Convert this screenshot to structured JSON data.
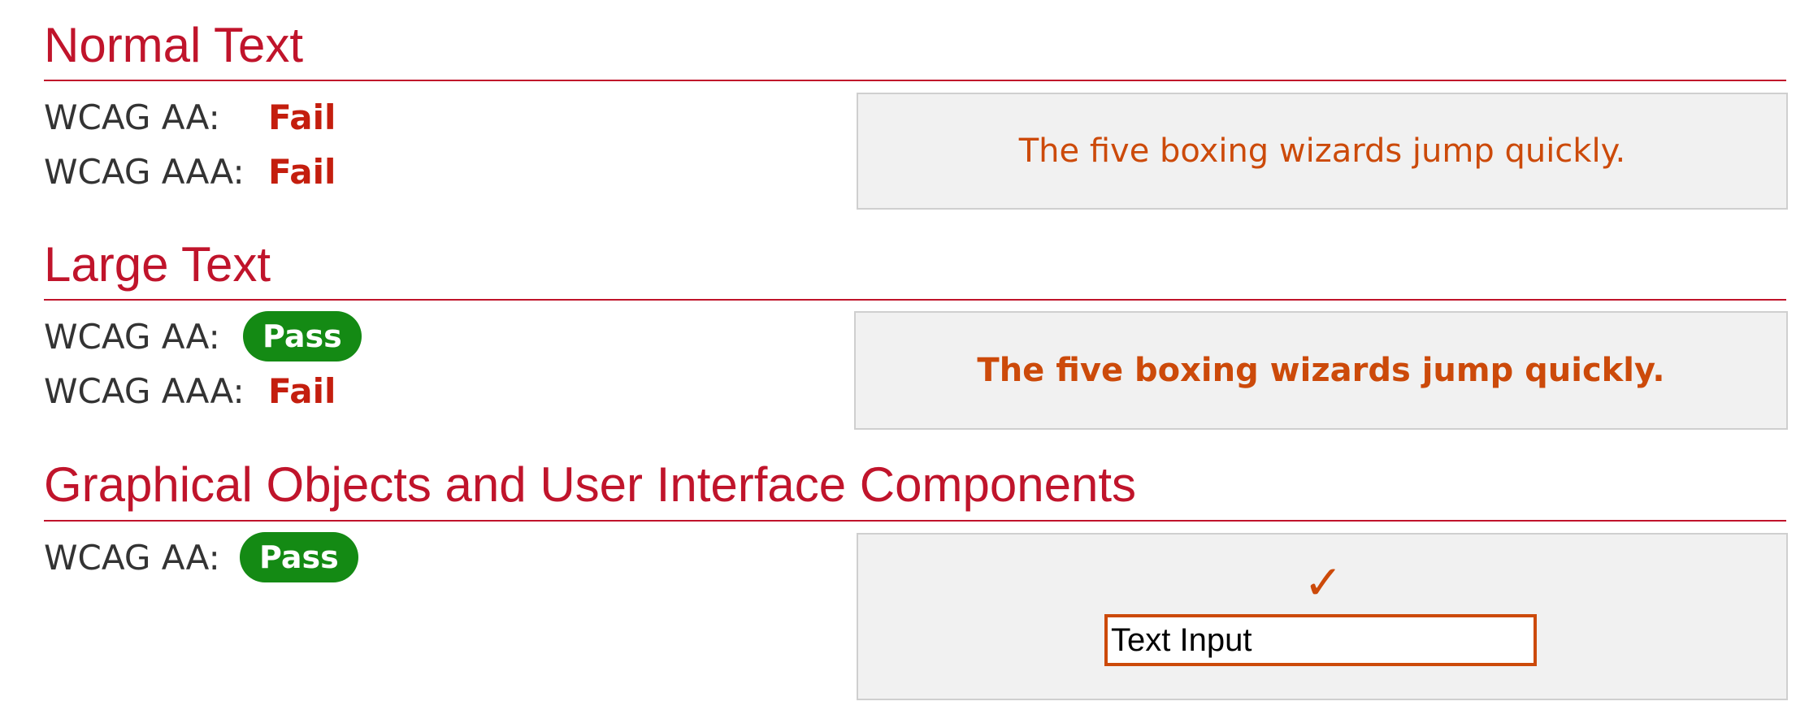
{
  "sections": [
    {
      "heading": "Normal Text",
      "rows": [
        {
          "label": "WCAG AA:",
          "result": "Fail",
          "status": "fail"
        },
        {
          "label": "WCAG AAA:",
          "result": "Fail",
          "status": "fail"
        }
      ],
      "sample_text": "The five boxing wizards jump quickly."
    },
    {
      "heading": "Large Text",
      "rows": [
        {
          "label": "WCAG AA:",
          "result": "Pass",
          "status": "pass"
        },
        {
          "label": "WCAG AAA:",
          "result": "Fail",
          "status": "fail"
        }
      ],
      "sample_text": "The five boxing wizards jump quickly."
    },
    {
      "heading": "Graphical Objects and User Interface Components",
      "rows": [
        {
          "label": "WCAG AA:",
          "result": "Pass",
          "status": "pass"
        }
      ],
      "sample_icon": "checkmark-icon",
      "sample_glyph": "✓",
      "sample_input_value": "Text Input"
    }
  ],
  "colors": {
    "heading": "#c0142b",
    "fail": "#c41e0e",
    "pass_badge": "#148a14",
    "sample_foreground": "#cc4a0a",
    "sample_background": "#f1f1f1"
  }
}
